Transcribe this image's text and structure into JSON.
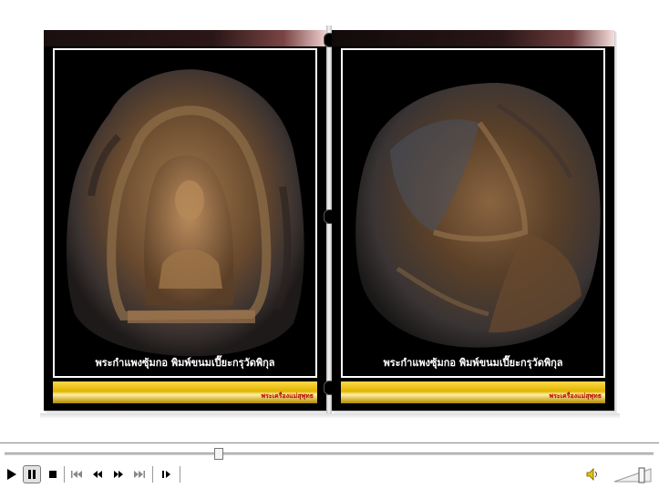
{
  "book": {
    "left_page": {
      "caption": "พระกำแพงซุ้มกอ พิมพ์ขนมเปี๊ยะกรุวัดพิกุล",
      "signature": "พระเครื่องแม่สุพุทธ"
    },
    "right_page": {
      "caption": "พระกำแพงซุ้มกอ พิมพ์ขนมเปี๊ยะกรุวัดพิกุล",
      "signature": "พระเครื่องแม่สุพุทธ"
    }
  },
  "player": {
    "seek_position": 0.33,
    "volume_level": 0.75,
    "buttons": {
      "play": "play-icon",
      "pause": "pause-icon",
      "stop": "stop-icon",
      "previous": "skip-back-icon",
      "rewind": "rewind-icon",
      "fast_forward": "fast-forward-icon",
      "next": "skip-forward-icon",
      "frame_step": "frame-step-icon",
      "volume": "speaker-icon"
    }
  },
  "colors": {
    "gold": "#e0b400",
    "page_bg": "#000000",
    "caption": "#ffffff",
    "signature": "#b00000"
  }
}
